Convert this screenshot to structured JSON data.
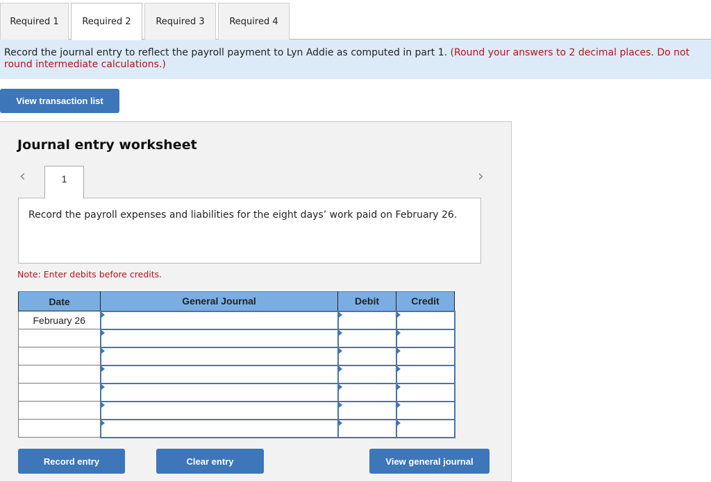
{
  "tabs": [
    {
      "label": "Required 1",
      "active": false
    },
    {
      "label": "Required 2",
      "active": true
    },
    {
      "label": "Required 3",
      "active": false
    },
    {
      "label": "Required 4",
      "active": false
    }
  ],
  "instruction": {
    "text": "Record the journal entry to reflect the payroll payment to Lyn Addie as computed in part 1.",
    "note": "(Round your answers to 2 decimal places. Do not round intermediate calculations.)"
  },
  "buttons": {
    "view_transaction_list": "View transaction list",
    "record_entry": "Record entry",
    "clear_entry": "Clear entry",
    "view_general_journal": "View general journal"
  },
  "worksheet": {
    "title": "Journal entry worksheet",
    "prev_icon": "‹",
    "next_icon": "›",
    "entry_number": "1",
    "description": "Record the payroll expenses and liabilities for the eight days’ work paid on February 26.",
    "note": "Note: Enter debits before credits."
  },
  "journal": {
    "headers": {
      "date": "Date",
      "account": "General Journal",
      "debit": "Debit",
      "credit": "Credit"
    },
    "rows": [
      {
        "date": "February 26",
        "account": "",
        "debit": "",
        "credit": ""
      },
      {
        "date": "",
        "account": "",
        "debit": "",
        "credit": ""
      },
      {
        "date": "",
        "account": "",
        "debit": "",
        "credit": ""
      },
      {
        "date": "",
        "account": "",
        "debit": "",
        "credit": ""
      },
      {
        "date": "",
        "account": "",
        "debit": "",
        "credit": ""
      },
      {
        "date": "",
        "account": "",
        "debit": "",
        "credit": ""
      },
      {
        "date": "",
        "account": "",
        "debit": "",
        "credit": ""
      }
    ]
  }
}
